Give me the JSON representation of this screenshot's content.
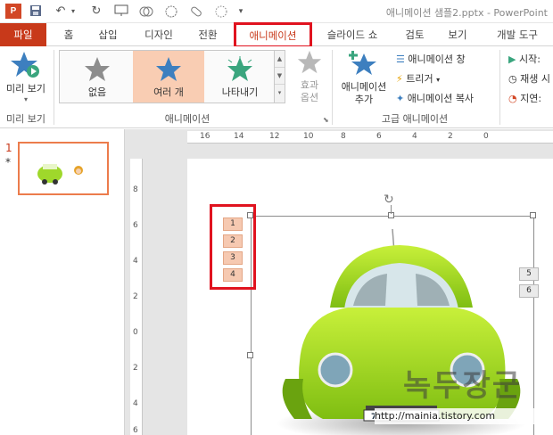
{
  "window": {
    "app_icon": "P",
    "title": "애니메이션 샘플2.pptx - PowerPoint"
  },
  "tabs": [
    {
      "label": "파일"
    },
    {
      "label": "홈"
    },
    {
      "label": "삽입"
    },
    {
      "label": "디자인"
    },
    {
      "label": "전환"
    },
    {
      "label": "애니메이션"
    },
    {
      "label": "슬라이드 쇼"
    },
    {
      "label": "검토"
    },
    {
      "label": "보기"
    },
    {
      "label": "개발 도구"
    }
  ],
  "ribbon": {
    "preview": {
      "button_label": "미리 보기",
      "group_label": "미리 보기"
    },
    "animation": {
      "group_label": "애니메이션",
      "gallery": [
        {
          "label": "없음",
          "selected": false,
          "color": "#8d8d8d"
        },
        {
          "label": "여러 개",
          "selected": true,
          "color": "#3d7fbf"
        },
        {
          "label": "나타내기",
          "selected": false,
          "color": "#3aa57e"
        }
      ],
      "effect_options_label": "효과 옵션"
    },
    "advanced": {
      "group_label": "고급 애니메이션",
      "add_animation_label": "애니메이션 추가",
      "animation_pane_label": "애니메이션 창",
      "trigger_label": "트리거",
      "painter_label": "애니메이션 복사"
    },
    "timing": {
      "start_label": "시작:",
      "playback_label": "재생 시",
      "delay_label": "지연:"
    }
  },
  "thumbnails": {
    "slide_number": "1",
    "marker": "*"
  },
  "ruler": {
    "horizontal_labels": [
      "16",
      "14",
      "12",
      "10",
      "8",
      "6",
      "4",
      "2",
      "0"
    ],
    "vertical_labels": [
      "8",
      "6",
      "4",
      "2",
      "0",
      "2",
      "4",
      "6"
    ]
  },
  "slide": {
    "anim_tags": [
      "1",
      "2",
      "3",
      "4"
    ],
    "anim_tags_right": [
      "5",
      "6"
    ],
    "plate": "725",
    "watermark": "녹두장군",
    "watermark_url": "http://mainia.tistory.com"
  }
}
